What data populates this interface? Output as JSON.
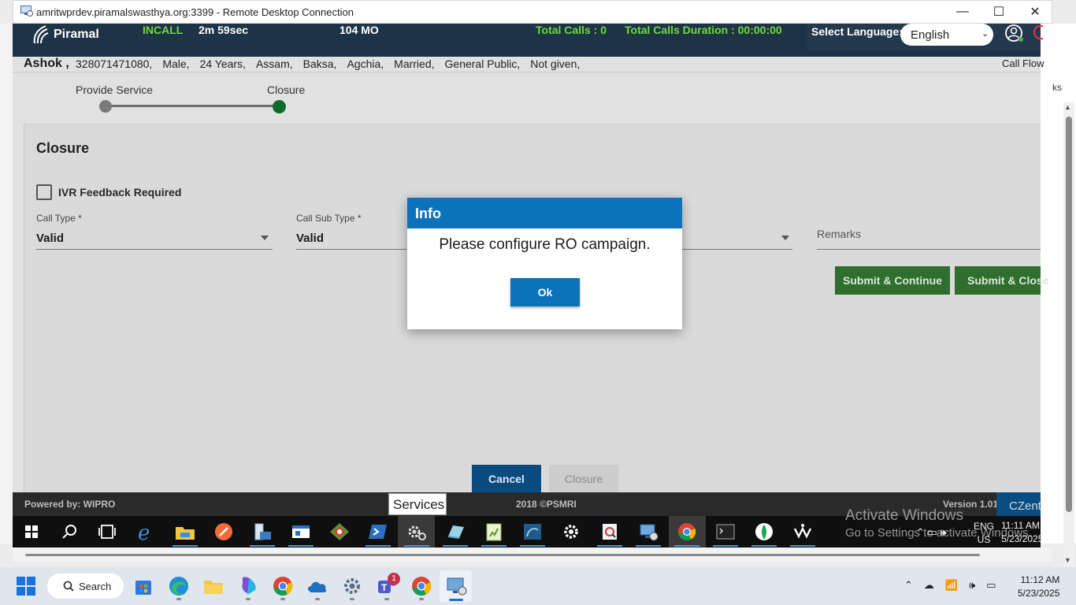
{
  "rdp": {
    "title": "amritwprdev.piramalswasthya.org:3399 - Remote Desktop Connection",
    "minimize": "—",
    "maximize": "☐",
    "close": "✕"
  },
  "header": {
    "logo_text": "Piramal",
    "call_status": "INCALL",
    "call_timer": "2m 59sec",
    "agent_role": "104 MO",
    "total_calls": "Total Calls : 0",
    "total_duration": "Total Calls Duration : 00:00:00",
    "language_label": "Select Language:",
    "language_selected": "English"
  },
  "patient": {
    "name": "Ashok ,",
    "details": [
      "328071471080,",
      "Male,",
      "24 Years,",
      "Assam,",
      "Baksa,",
      "Agchia,",
      "Married,",
      "General Public,",
      "Not given,"
    ],
    "call_flow": "Call Flow"
  },
  "stepper": {
    "step1": "Provide Service",
    "step2": "Closure"
  },
  "closure": {
    "heading": "Closure",
    "ivr_label": "IVR Feedback Required",
    "call_type_label": "Call Type *",
    "call_type_value": "Valid",
    "call_sub_type_label": "Call Sub Type *",
    "call_sub_type_value": "Valid",
    "remarks_placeholder": "Remarks",
    "submit_continue": "Submit & Continue",
    "submit_close": "Submit & Close",
    "cancel": "Cancel",
    "closure_button": "Closure"
  },
  "footer": {
    "powered_by": "Powered by: WIPRO",
    "copyright": "2018 ©PSMRI",
    "version": "Version 1.01",
    "czentrix": "CZent"
  },
  "tooltip": {
    "services": "Services"
  },
  "remote_taskbar": {
    "activate_line1": "Activate Windows",
    "activate_line2": "Go to Settings to activate Windows.",
    "lang_line1": "ENG",
    "lang_line2": "US",
    "time": "11:11 AM",
    "date": "5/23/2025"
  },
  "dialog": {
    "title": "Info",
    "message": "Please configure RO campaign.",
    "ok": "Ok"
  },
  "host": {
    "right_text": "ks",
    "search_label": "Search",
    "teams_badge": "1",
    "time": "11:12 AM",
    "date": "5/23/2025"
  },
  "colors": {
    "header_bg": "#1d3347",
    "accent_green": "#6ddc3a",
    "dialog_blue": "#0c73bb",
    "button_green": "#2f6e2e",
    "cancel_blue": "#0a4b80"
  }
}
